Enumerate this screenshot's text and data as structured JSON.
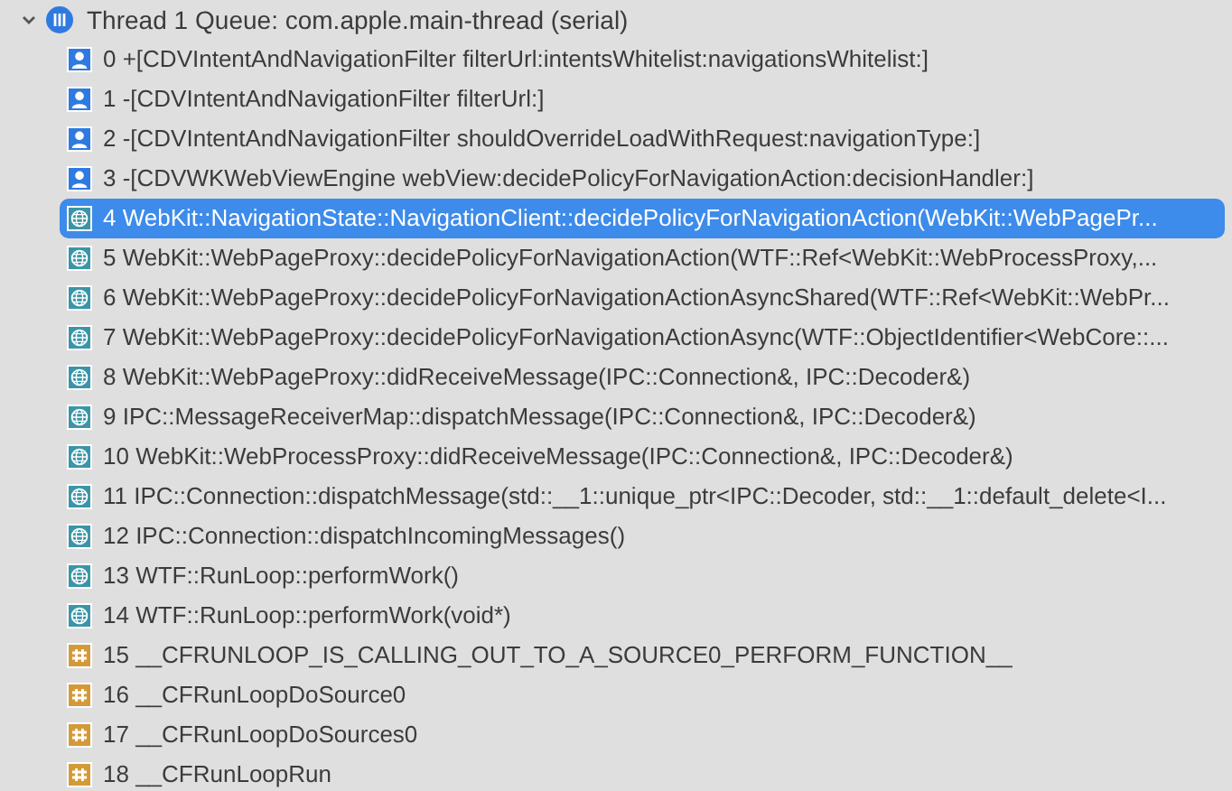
{
  "thread": {
    "title": "Thread 1",
    "queue": "Queue: com.apple.main-thread (serial)",
    "expanded": true
  },
  "frames": [
    {
      "kind": "user",
      "label": "0 +[CDVIntentAndNavigationFilter filterUrl:intentsWhitelist:navigationsWhitelist:]",
      "selected": false
    },
    {
      "kind": "user",
      "label": "1 -[CDVIntentAndNavigationFilter filterUrl:]",
      "selected": false
    },
    {
      "kind": "user",
      "label": "2 -[CDVIntentAndNavigationFilter shouldOverrideLoadWithRequest:navigationType:]",
      "selected": false
    },
    {
      "kind": "user",
      "label": "3 -[CDVWKWebViewEngine webView:decidePolicyForNavigationAction:decisionHandler:]",
      "selected": false
    },
    {
      "kind": "framework",
      "label": "4 WebKit::NavigationState::NavigationClient::decidePolicyForNavigationAction(WebKit::WebPagePr...",
      "selected": true
    },
    {
      "kind": "framework",
      "label": "5 WebKit::WebPageProxy::decidePolicyForNavigationAction(WTF::Ref<WebKit::WebProcessProxy,...",
      "selected": false
    },
    {
      "kind": "framework",
      "label": "6 WebKit::WebPageProxy::decidePolicyForNavigationActionAsyncShared(WTF::Ref<WebKit::WebPr...",
      "selected": false
    },
    {
      "kind": "framework",
      "label": "7 WebKit::WebPageProxy::decidePolicyForNavigationActionAsync(WTF::ObjectIdentifier<WebCore::...",
      "selected": false
    },
    {
      "kind": "framework",
      "label": "8 WebKit::WebPageProxy::didReceiveMessage(IPC::Connection&, IPC::Decoder&)",
      "selected": false
    },
    {
      "kind": "framework",
      "label": "9 IPC::MessageReceiverMap::dispatchMessage(IPC::Connection&, IPC::Decoder&)",
      "selected": false
    },
    {
      "kind": "framework",
      "label": "10 WebKit::WebProcessProxy::didReceiveMessage(IPC::Connection&, IPC::Decoder&)",
      "selected": false
    },
    {
      "kind": "framework",
      "label": "11 IPC::Connection::dispatchMessage(std::__1::unique_ptr<IPC::Decoder, std::__1::default_delete<I...",
      "selected": false
    },
    {
      "kind": "framework",
      "label": "12 IPC::Connection::dispatchIncomingMessages()",
      "selected": false
    },
    {
      "kind": "framework",
      "label": "13 WTF::RunLoop::performWork()",
      "selected": false
    },
    {
      "kind": "framework",
      "label": "14 WTF::RunLoop::performWork(void*)",
      "selected": false
    },
    {
      "kind": "system",
      "label": "15 __CFRUNLOOP_IS_CALLING_OUT_TO_A_SOURCE0_PERFORM_FUNCTION__",
      "selected": false
    },
    {
      "kind": "system",
      "label": "16 __CFRunLoopDoSource0",
      "selected": false
    },
    {
      "kind": "system",
      "label": "17 __CFRunLoopDoSources0",
      "selected": false
    },
    {
      "kind": "system",
      "label": "18 __CFRunLoopRun",
      "selected": false
    }
  ]
}
